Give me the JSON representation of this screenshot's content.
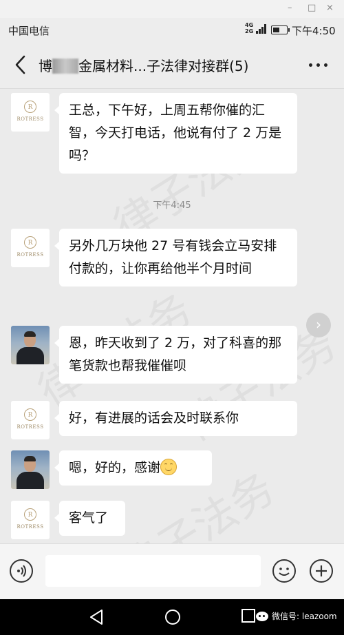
{
  "window_controls": {
    "minimize": "–",
    "restore": "□",
    "close": "×"
  },
  "status_bar": {
    "carrier": "中国电信",
    "network_top": "4G",
    "network_bottom": "2G",
    "time": "下午4:50"
  },
  "header": {
    "title_prefix": "博",
    "title_suffix": "金属材料...子法律对接群(5)"
  },
  "watermark_text": "律子法务",
  "messages": [
    {
      "sender": "rotress",
      "text": "王总，下午好，上周五帮你催的汇智，今天打电话，他说有付了 2 万是吗？"
    },
    {
      "sender": "person",
      "text": ""
    }
  ],
  "chat": {
    "logo_letter": "R",
    "logo_brand": "ROTRESS",
    "m1": "王总，下午好，上周五帮你催的汇智，今天打电话，他说有付了 2 万是吗？",
    "timestamp": "下午4:45",
    "m2": "另外几万块他 27 号有钱会立马安排付款的，让你再给他半个月时间",
    "m3": "恩，昨天收到了 2 万，对了科喜的那笔货款也帮我催催呗",
    "m4": "好，有进展的话会及时联系你",
    "m5": "嗯，好的，感谢",
    "m6": "客气了"
  },
  "input": {
    "placeholder": ""
  },
  "footer": {
    "wechat_account": "微信号: leazoom"
  },
  "colors": {
    "background": "#ebebeb",
    "bubble": "#ffffff",
    "navbar": "#000000"
  },
  "icons": [
    "back-icon",
    "more-icon",
    "voice-icon",
    "emoji-icon",
    "plus-icon",
    "nav-back-icon",
    "nav-home-icon",
    "nav-recents-icon",
    "wechat-icon"
  ]
}
